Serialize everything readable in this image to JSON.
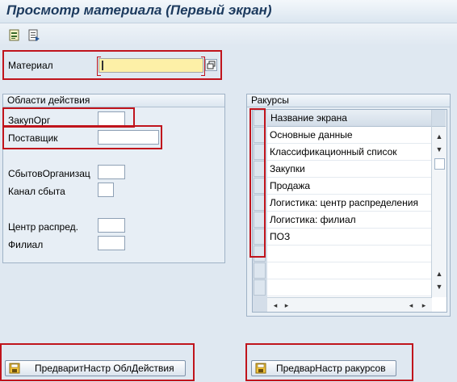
{
  "window": {
    "title": "Просмотр материала (Первый экран)"
  },
  "toolbar": {
    "icons": [
      "select-views-icon",
      "org-levels-icon"
    ]
  },
  "material": {
    "label": "Материал",
    "value": ""
  },
  "org_group": {
    "title": "Области действия",
    "fields": [
      {
        "label": "ЗакупОрг",
        "value": ""
      },
      {
        "label": "Поставщик",
        "value": ""
      },
      {
        "label": "СбытовОрганизац",
        "value": ""
      },
      {
        "label": "Канал сбыта",
        "value": ""
      },
      {
        "label": "Центр распред.",
        "value": ""
      },
      {
        "label": "Филиал",
        "value": ""
      }
    ]
  },
  "views_group": {
    "title": "Ракурсы",
    "header": "Название экрана",
    "rows": [
      "Основные данные",
      "Классификационный список",
      "Закупки",
      "Продажа",
      "Логистика: центр распределения",
      "Логистика: филиал",
      "ПОЗ"
    ]
  },
  "buttons": {
    "org_defaults": "ПредваритНастр ОблДействия",
    "view_defaults": "ПредварНастр ракурсов"
  },
  "colors": {
    "highlight": "#c0141c",
    "required_field": "#fdf0a7"
  }
}
